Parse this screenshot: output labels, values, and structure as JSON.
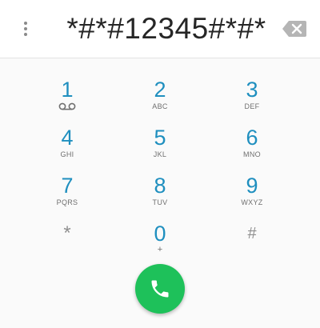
{
  "display": {
    "digits": "*#*#12345#*#*"
  },
  "icons": {
    "menu": "overflow-menu-icon",
    "backspace": "backspace-icon",
    "voicemail": "voicemail-icon",
    "call": "phone-icon"
  },
  "keypad": {
    "k1": {
      "num": "1",
      "letters": ""
    },
    "k2": {
      "num": "2",
      "letters": "ABC"
    },
    "k3": {
      "num": "3",
      "letters": "DEF"
    },
    "k4": {
      "num": "4",
      "letters": "GHI"
    },
    "k5": {
      "num": "5",
      "letters": "JKL"
    },
    "k6": {
      "num": "6",
      "letters": "MNO"
    },
    "k7": {
      "num": "7",
      "letters": "PQRS"
    },
    "k8": {
      "num": "8",
      "letters": "TUV"
    },
    "k9": {
      "num": "9",
      "letters": "WXYZ"
    },
    "kstar": {
      "num": "*"
    },
    "k0": {
      "num": "0",
      "letters": "+"
    },
    "khash": {
      "num": "#"
    }
  },
  "colors": {
    "digit": "#1f8fbf",
    "call_button": "#1ec15a",
    "background": "#fafafa"
  }
}
